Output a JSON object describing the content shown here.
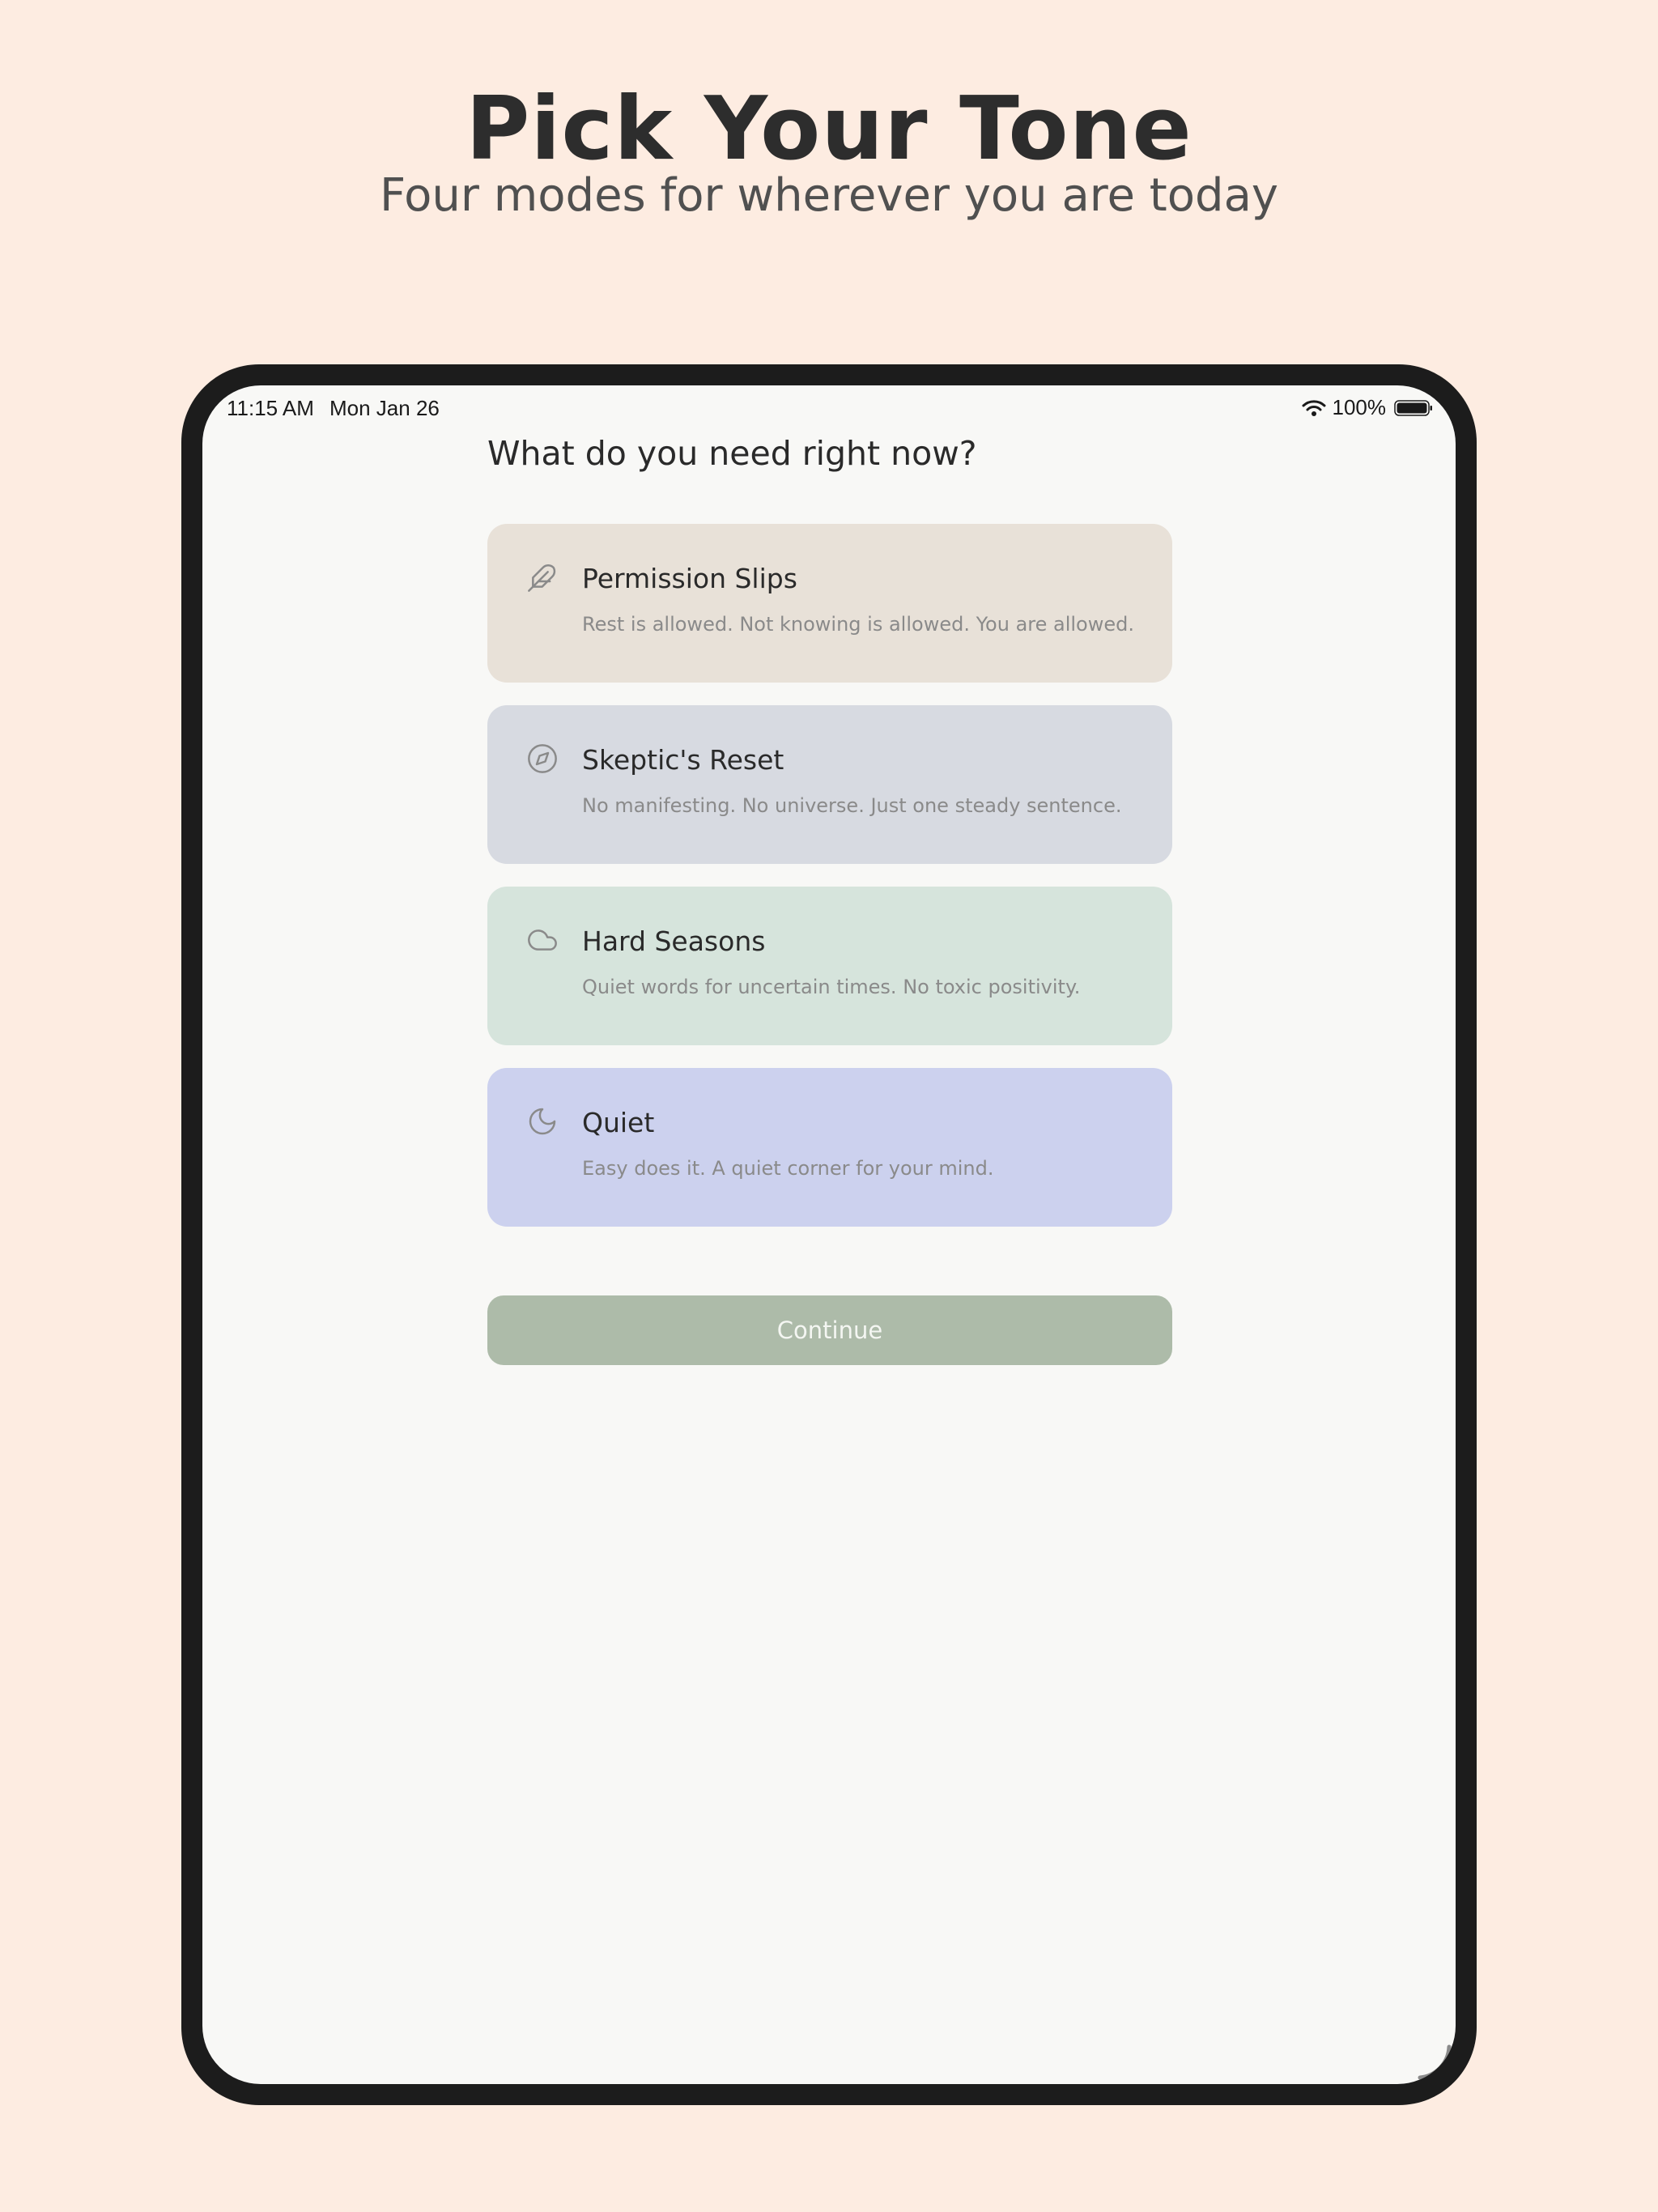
{
  "promo": {
    "title": "Pick Your Tone",
    "subtitle": "Four modes for wherever you are today"
  },
  "status_bar": {
    "time": "11:15 AM",
    "date": "Mon Jan 26",
    "battery": "100%"
  },
  "screen": {
    "question": "What do you need right now?",
    "options": [
      {
        "title": "Permission Slips",
        "description": "Rest is allowed. Not knowing is allowed. You are allowed.",
        "icon": "feather-icon",
        "color": "#e8e1d8"
      },
      {
        "title": "Skeptic's Reset",
        "description": "No manifesting. No universe. Just one steady sentence.",
        "icon": "compass-icon",
        "color": "#d7dae1"
      },
      {
        "title": "Hard Seasons",
        "description": "Quiet words for uncertain times. No toxic positivity.",
        "icon": "cloud-icon",
        "color": "#d6e4dc"
      },
      {
        "title": "Quiet",
        "description": "Easy does it. A quiet corner for your mind.",
        "icon": "moon-icon",
        "color": "#ccd1ee"
      }
    ],
    "continue_label": "Continue"
  },
  "colors": {
    "page_background": "#fdece1",
    "device_frame": "#1c1c1c",
    "screen_background": "#f8f8f6",
    "continue_button": "#adbba9"
  }
}
